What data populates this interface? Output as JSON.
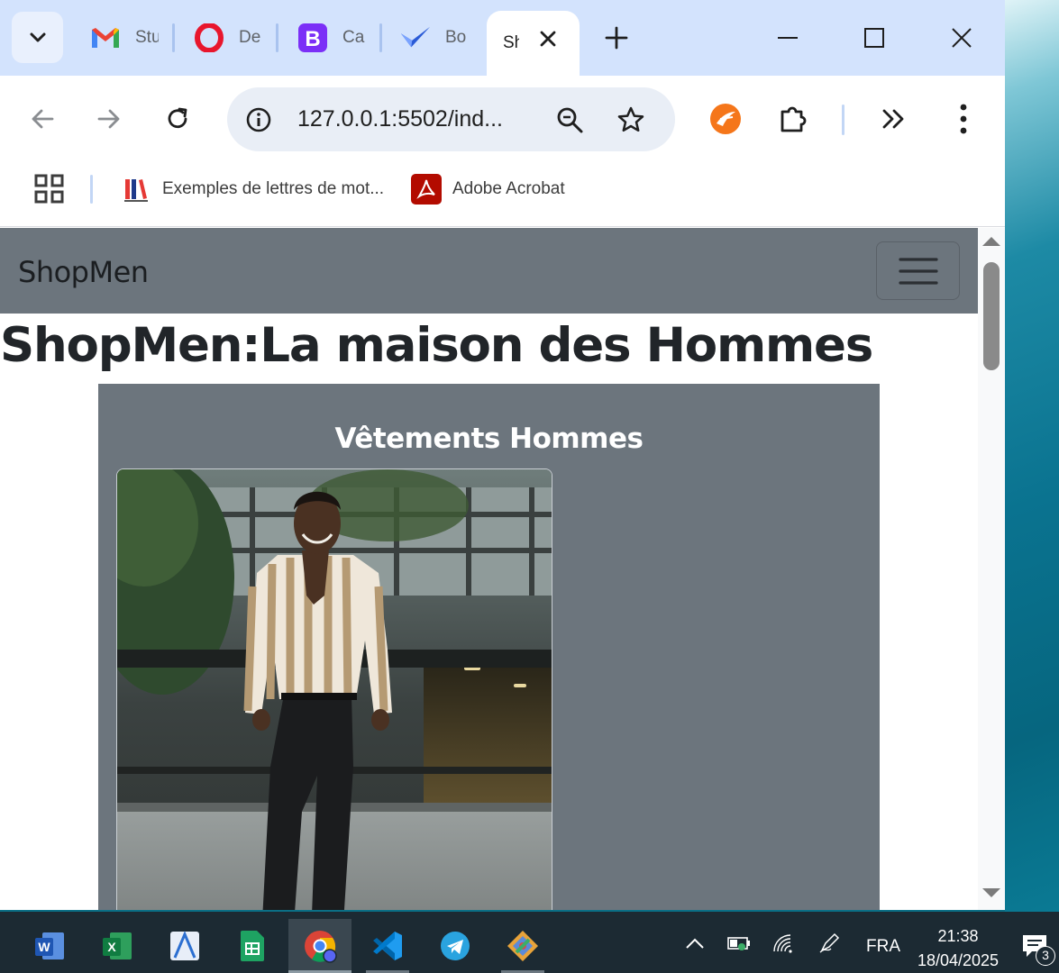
{
  "browser": {
    "tabs": [
      {
        "title": "Stu",
        "icon": "gmail-icon"
      },
      {
        "title": "De",
        "icon": "opera-icon"
      },
      {
        "title": "Ca",
        "icon": "bootstrap-icon"
      },
      {
        "title": "Bo",
        "icon": "checkmark-app-icon"
      },
      {
        "title": "Sh",
        "icon": "page-icon",
        "active": true
      }
    ],
    "url": "127.0.0.1:5502/ind...",
    "bookmarks": [
      {
        "label": "Exemples de lettres de mot...",
        "icon": "books-icon"
      },
      {
        "label": "Adobe Acrobat",
        "icon": "acrobat-icon"
      }
    ]
  },
  "page": {
    "brand": "ShopMen",
    "title": "ShopMen:La maison des Hommes",
    "section_title": "Vêtements Hommes"
  },
  "taskbar": {
    "apps": [
      "word-icon",
      "excel-icon",
      "arcgis-icon",
      "sheets-icon",
      "chrome-icon",
      "vscode-icon",
      "telegram-icon",
      "git-icon"
    ],
    "language": "FRA",
    "time": "21:38",
    "date": "18/04/2025",
    "notification_count": "3"
  },
  "colors": {
    "tabstrip": "#d3e3fd",
    "navbar": "#6c757d",
    "taskbar": "#1c2a33"
  }
}
